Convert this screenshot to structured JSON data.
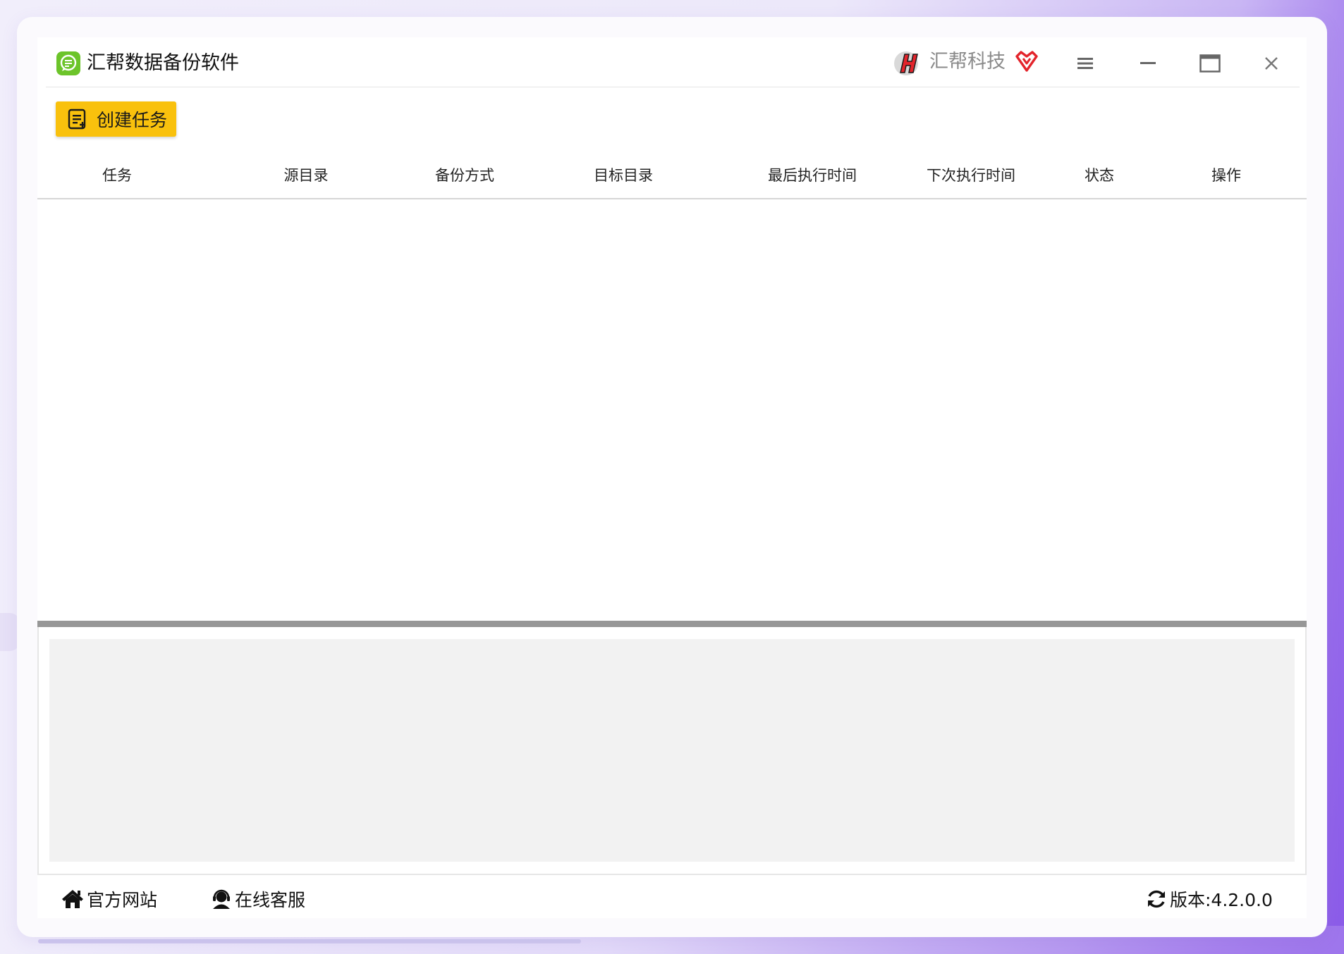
{
  "app": {
    "title": "汇帮数据备份软件",
    "brand_name": "汇帮科技",
    "icon": "chat-bubble-icon",
    "brand_logo": "lightning-h-logo",
    "vip_icon": "vip-heart-icon"
  },
  "window_controls": {
    "menu_icon": "hamburger-menu-icon",
    "minimize_icon": "minimize-icon",
    "maximize_icon": "maximize-icon",
    "close_icon": "close-icon"
  },
  "toolbar": {
    "create_task_label": "创建任务",
    "create_task_icon": "task-list-icon",
    "accent_color": "#f9c10d"
  },
  "table": {
    "columns": [
      "任务",
      "源目录",
      "备份方式",
      "目标目录",
      "最后执行时间",
      "下次执行时间",
      "状态",
      "操作"
    ],
    "rows": []
  },
  "footer": {
    "official_site_label": "官方网站",
    "online_service_label": "在线客服",
    "version_label": "版本:4.2.0.0",
    "home_icon": "home-icon",
    "service_icon": "headset-user-icon",
    "refresh_icon": "refresh-icon"
  }
}
